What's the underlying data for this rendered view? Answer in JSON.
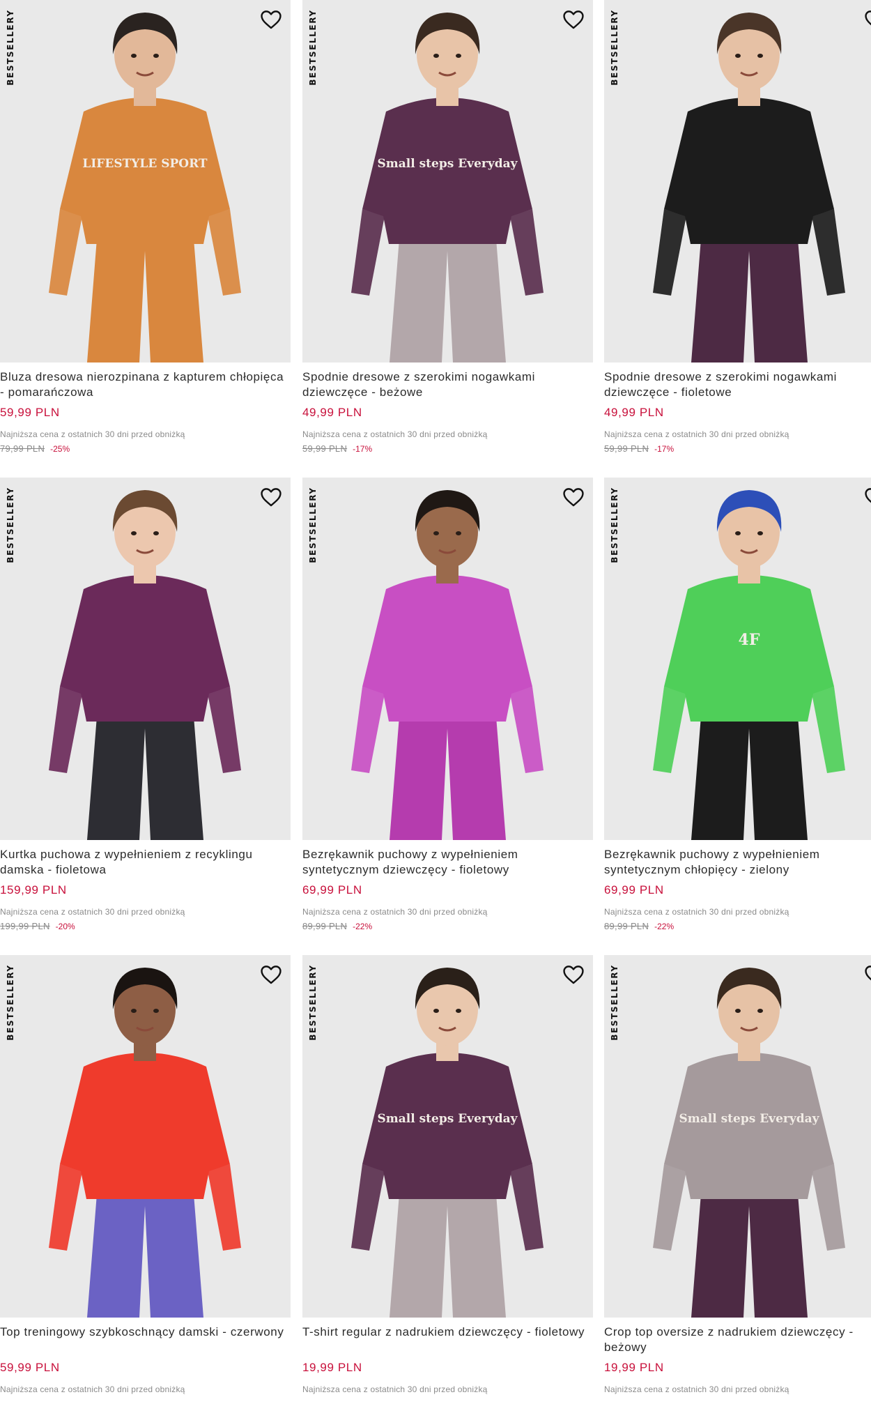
{
  "products": [
    {
      "badge": "BESTSELLERY",
      "title": "Bluza dresowa nierozpinana z kapturem chłopięca - pomarańczowa",
      "price": "59,99 PLN",
      "lowest_label": "Najniższa cena z ostatnich 30 dni przed obniżką",
      "old_price": "79,99 PLN",
      "discount": "-25%",
      "image": {
        "background": "#e9e9e9",
        "top_color": "#d9873e",
        "bottom_color": "#d9873e",
        "skin": "#e2b899",
        "hair": "#2a2320",
        "print_text": "LIFESTYLE SPORT"
      }
    },
    {
      "badge": "BESTSELLERY",
      "title": "Spodnie dresowe z szerokimi nogawkami dziewczęce - beżowe",
      "price": "49,99 PLN",
      "lowest_label": "Najniższa cena z ostatnich 30 dni przed obniżką",
      "old_price": "59,99 PLN",
      "discount": "-17%",
      "image": {
        "background": "#e9e9e9",
        "top_color": "#5a2f4e",
        "bottom_color": "#b3a7aa",
        "skin": "#e8c4a8",
        "hair": "#3a2a20",
        "print_text": "Small steps Everyday"
      }
    },
    {
      "badge": "BESTSELLERY",
      "title": "Spodnie dresowe z szerokimi nogawkami dziewczęce - fioletowe",
      "price": "49,99 PLN",
      "lowest_label": "Najniższa cena z ostatnich 30 dni przed obniżką",
      "old_price": "59,99 PLN",
      "discount": "-17%",
      "image": {
        "background": "#e9e9e9",
        "top_color": "#1c1c1c",
        "bottom_color": "#4d2a44",
        "skin": "#e6c1a5",
        "hair": "#4a3528",
        "print_text": ""
      }
    },
    {
      "badge": "BESTSELLERY",
      "title": "Kurtka puchowa z wypełnieniem z recyklingu damska - fioletowa",
      "price": "159,99 PLN",
      "lowest_label": "Najniższa cena z ostatnich 30 dni przed obniżką",
      "old_price": "199,99 PLN",
      "discount": "-20%",
      "image": {
        "background": "#e9e9e9",
        "top_color": "#6b2a5a",
        "bottom_color": "#2d2d33",
        "skin": "#ecc7ae",
        "hair": "#6b4a32",
        "print_text": ""
      }
    },
    {
      "badge": "BESTSELLERY",
      "title": "Bezrękawnik puchowy z wypełnieniem syntetycznym dziewczęcy - fioletowy",
      "price": "69,99 PLN",
      "lowest_label": "Najniższa cena z ostatnich 30 dni przed obniżką",
      "old_price": "89,99 PLN",
      "discount": "-22%",
      "image": {
        "background": "#e9e9e9",
        "top_color": "#c84fc3",
        "bottom_color": "#b53cae",
        "skin": "#9a6a4c",
        "hair": "#1f1814",
        "print_text": ""
      }
    },
    {
      "badge": "BESTSELLERY",
      "title": "Bezrękawnik puchowy z wypełnieniem syntetycznym chłopięcy - zielony",
      "price": "69,99 PLN",
      "lowest_label": "Najniższa cena z ostatnich 30 dni przed obniżką",
      "old_price": "89,99 PLN",
      "discount": "-22%",
      "image": {
        "background": "#e9e9e9",
        "top_color": "#4fcf59",
        "bottom_color": "#1c1c1c",
        "skin": "#e8c3a7",
        "hair": "#2d4fb8",
        "print_text": "4F"
      }
    },
    {
      "badge": "BESTSELLERY",
      "title": "Top treningowy szybkoschnący damski - czerwony",
      "price": "59,99 PLN",
      "lowest_label": "Najniższa cena z ostatnich 30 dni przed obniżką",
      "old_price": "",
      "discount": "",
      "image": {
        "background": "#e9e9e9",
        "top_color": "#ef3b2c",
        "bottom_color": "#6b62c4",
        "skin": "#8e5e45",
        "hair": "#1a1411",
        "print_text": ""
      }
    },
    {
      "badge": "BESTSELLERY",
      "title": "T-shirt regular z nadrukiem dziewczęcy - fioletowy",
      "price": "19,99 PLN",
      "lowest_label": "Najniższa cena z ostatnich 30 dni przed obniżką",
      "old_price": "",
      "discount": "",
      "image": {
        "background": "#e9e9e9",
        "top_color": "#5a2f4e",
        "bottom_color": "#b3a7aa",
        "skin": "#e9c7ad",
        "hair": "#2a2019",
        "print_text": "Small steps Everyday"
      }
    },
    {
      "badge": "BESTSELLERY",
      "title": "Crop top oversize z nadrukiem dziewczęcy - beżowy",
      "price": "19,99 PLN",
      "lowest_label": "Najniższa cena z ostatnich 30 dni przed obniżką",
      "old_price": "",
      "discount": "",
      "image": {
        "background": "#e9e9e9",
        "top_color": "#a59a9c",
        "bottom_color": "#4d2a44",
        "skin": "#e6c2a6",
        "hair": "#3a2a1f",
        "print_text": "Small steps Everyday"
      }
    }
  ],
  "icons": {
    "favorite": "heart-outline-icon"
  }
}
